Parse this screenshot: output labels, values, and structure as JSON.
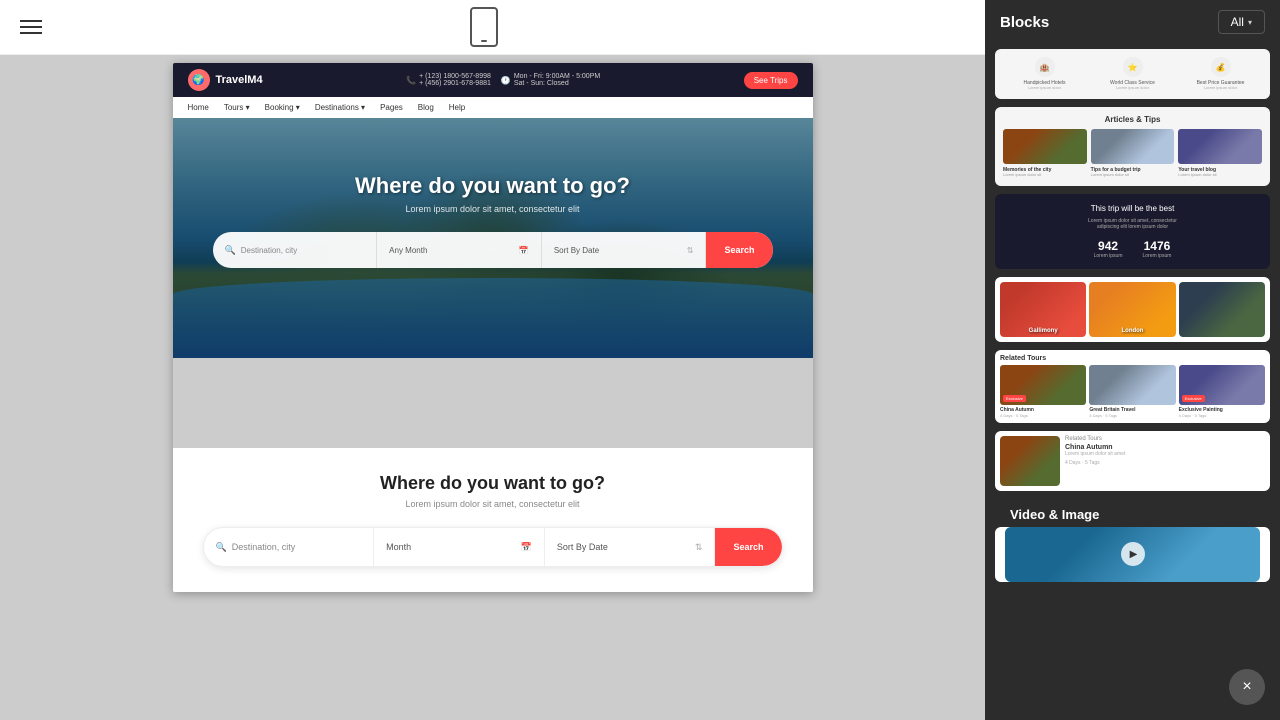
{
  "toolbar": {
    "hamburger_label": "menu"
  },
  "right_panel": {
    "title": "Blocks",
    "all_button": "All",
    "video_image_label": "Video & Image"
  },
  "hero": {
    "title": "Where do you want to go?",
    "subtitle": "Lorem ipsum dolor sit amet, consectetur elit",
    "search_placeholder": "Destination, city",
    "month_placeholder": "Any Month",
    "sort_placeholder": "Sort By Date",
    "search_button": "Search"
  },
  "second_section": {
    "title": "Where do you want to go?",
    "subtitle": "Lorem ipsum dolor sit amet, consectetur elit",
    "search_placeholder": "Destination, city",
    "month_placeholder": "Month",
    "sort_placeholder": "Sort By Date",
    "search_button": "Search"
  },
  "nav": {
    "items": [
      "Home",
      "Tours",
      "Booking",
      "Destinations",
      "Pages",
      "Blog",
      "Help"
    ]
  },
  "site_header": {
    "logo": "TravelM4",
    "phone1": "+ (123) 1800-567-8998",
    "phone2": "+ (456) 2901-678-9881",
    "hours1": "Mon - Fri: 9:00AM - 5:00PM",
    "hours2": "Sat - Sun: Closed",
    "cta": "See Trips"
  },
  "blocks": {
    "features": {
      "items": [
        {
          "icon": "🏨",
          "label": "Handpicked Hotels"
        },
        {
          "icon": "⭐",
          "label": "World Class Service"
        },
        {
          "icon": "💰",
          "label": "Best Price Guarantee"
        }
      ]
    },
    "articles": {
      "title": "Articles & Tips",
      "items": [
        {
          "title": "Memories of the city",
          "desc": "Lorem ipsum dolor sit"
        },
        {
          "title": "Tips for a budget trip",
          "desc": "Lorem ipsum dolor sit"
        },
        {
          "title": "Your travel blog",
          "desc": "Lorem ipsum dolor sit"
        }
      ]
    },
    "stats": {
      "title": "This trip will be the best",
      "desc": "Lorem ipsum dolor sit amet, consectetur\nadipiscing elit lorem ipsum dolor",
      "number1": "942",
      "label1": "Lorem ipsum",
      "number2": "1476",
      "label2": "Lorem ipsum"
    },
    "destinations": {
      "items": [
        {
          "label": "Gallimony",
          "type": "card1"
        },
        {
          "label": "London",
          "type": "card2"
        },
        {
          "label": "",
          "type": "card3"
        }
      ]
    },
    "related_tours": {
      "title": "Related Tours",
      "items": [
        {
          "name": "China Autumn",
          "badge": "Exclusive",
          "info": "4 Days · 5 Tags"
        },
        {
          "name": "Great Britain Travel",
          "badge": "",
          "info": "4 Days · 5 Tags"
        },
        {
          "name": "Exclusive Painting",
          "badge": "Exclusive",
          "info": "4 Days · 5 Tags"
        }
      ]
    },
    "single_tour": {
      "header": "Related Tours",
      "name": "China Autumn",
      "desc": "Lorem ipsum dolor sit amet",
      "meta": "4 Days · 5 Tags"
    }
  },
  "close_button": "×"
}
